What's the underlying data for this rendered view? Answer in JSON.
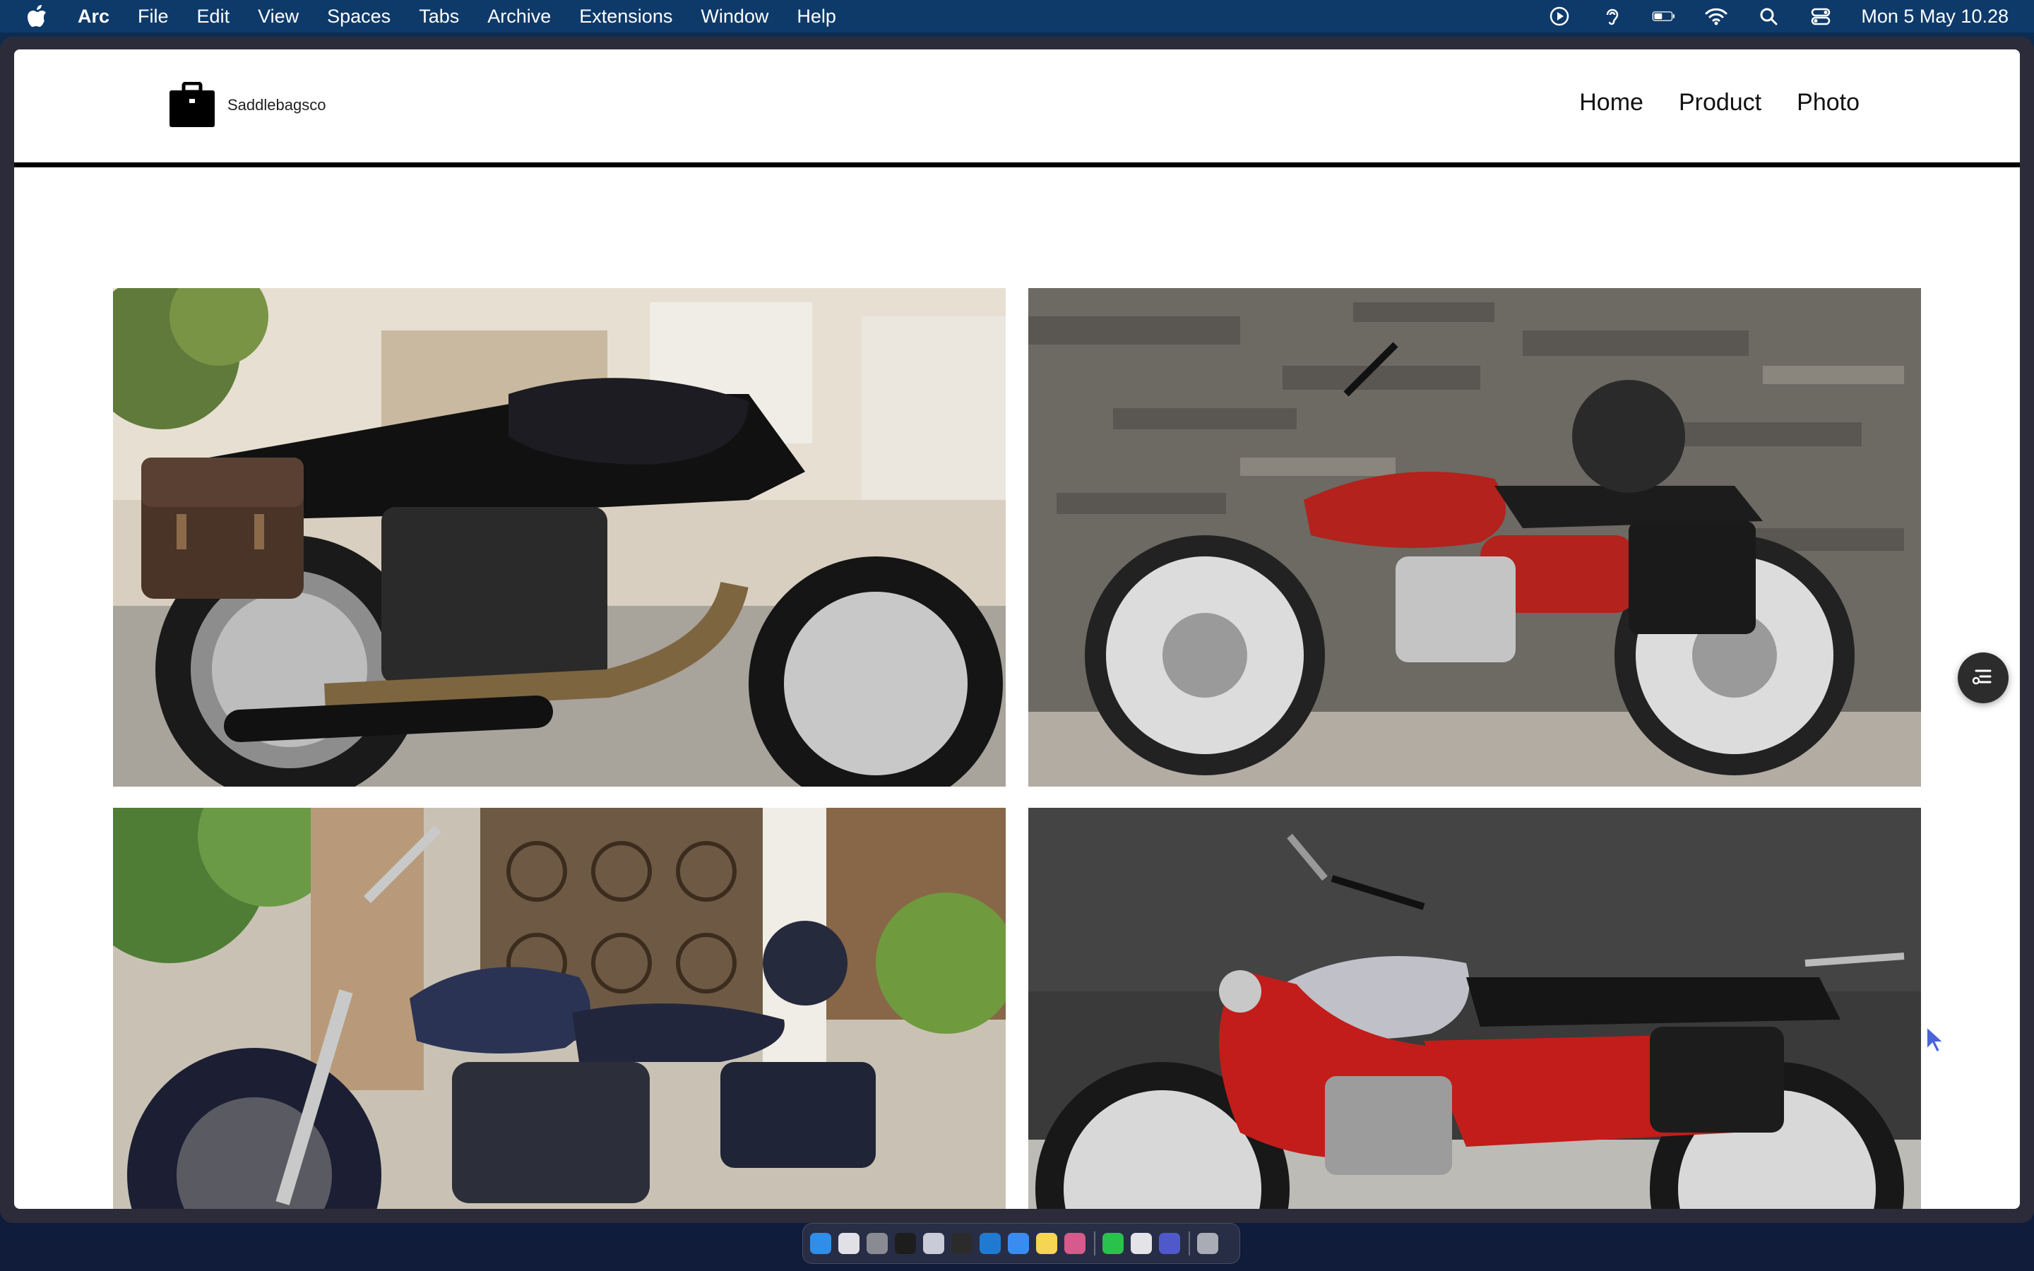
{
  "menubar": {
    "app_name": "Arc",
    "items": [
      "File",
      "Edit",
      "View",
      "Spaces",
      "Tabs",
      "Archive",
      "Extensions",
      "Window",
      "Help"
    ],
    "status_icons": [
      "play-circle-icon",
      "hearing-icon",
      "battery-icon",
      "wifi-icon",
      "search-icon",
      "control-center-icon"
    ],
    "clock": "Mon 5 May  10.28"
  },
  "site": {
    "brand_name": "Saddlebagsco",
    "nav": [
      "Home",
      "Product",
      "Photo"
    ]
  },
  "photos": [
    {
      "name": "photo-black-cafe-racer"
    },
    {
      "name": "photo-red-honda-motorcycle"
    },
    {
      "name": "photo-navy-cruiser-motorcycle"
    },
    {
      "name": "photo-red-classic-honda"
    }
  ],
  "dock": {
    "apps": [
      "finder",
      "launchpad",
      "settings",
      "terminal",
      "disk-utility",
      "console",
      "vscode",
      "safari",
      "notes",
      "photos-app",
      "whatsapp",
      "preview",
      "teams",
      "trash"
    ]
  },
  "colors": {
    "menubar": "#0e3a6a",
    "header_border": "#000000",
    "accent_red": "#b3221c"
  }
}
